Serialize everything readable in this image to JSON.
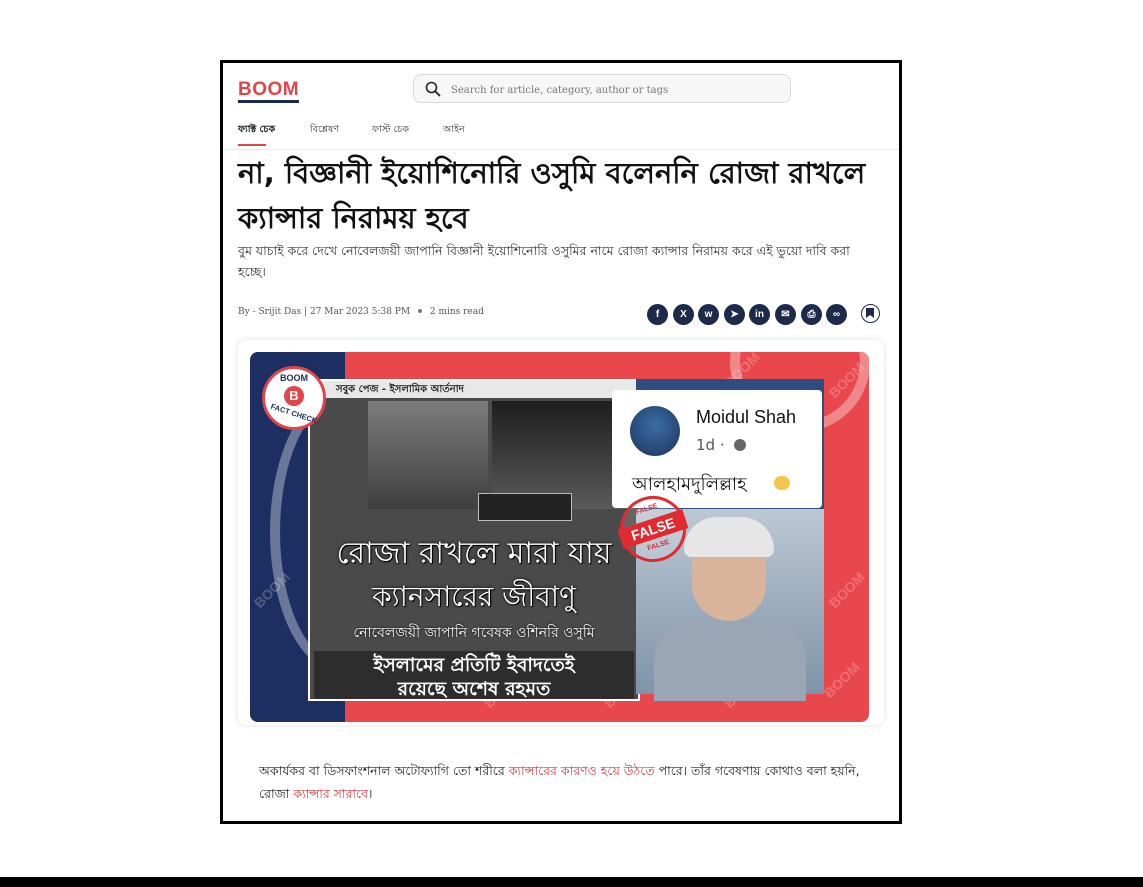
{
  "site": {
    "logo": "BOOM"
  },
  "search": {
    "placeholder": "Search for article, category, author or tags"
  },
  "nav": {
    "tabs": [
      {
        "label": "ফ্যাক্ট চেক",
        "active": true
      },
      {
        "label": "বিশ্লেষণ",
        "active": false
      },
      {
        "label": "ফাস্ট চেক",
        "active": false
      },
      {
        "label": "আইন",
        "active": false
      }
    ]
  },
  "article": {
    "headline": "না, বিজ্ঞানী ইয়োশিনোরি ওসুমি বলেননি রোজা রাখলে ক্যান্সার নিরাময় হবে",
    "subtitle": "বুম যাচাই করে দেখে নোবেলজয়ী জাপানি বিজ্ঞানী ইয়োশিনোরি ওসুমির নামে রোজা ক্যান্সার নিরাময় করে এই ভুয়ো দাবি করা হচ্ছে।",
    "byline": {
      "author": "By - Srijit Das",
      "date": "27 Mar 2023 5:38 PM",
      "read_time": "2 mins read"
    },
    "share_buttons": [
      {
        "name": "facebook",
        "glyph": "f"
      },
      {
        "name": "x-twitter",
        "glyph": "X"
      },
      {
        "name": "whatsapp",
        "glyph": "w"
      },
      {
        "name": "telegram",
        "glyph": "➤"
      },
      {
        "name": "linkedin",
        "glyph": "in"
      },
      {
        "name": "email",
        "glyph": "✉"
      },
      {
        "name": "print",
        "glyph": "⎙"
      },
      {
        "name": "copy-link",
        "glyph": "∞"
      }
    ],
    "body_text": {
      "part1": "অকার্যকর বা ডিসফাংশনাল অটোফ্যাগি তো শরীরে ",
      "link1": "ক্যান্সারের কারণও হয়ে উঠতে",
      "part2": " পারে। তাঁর গবেষণায় কোথাও বলা হয়নি, রোজা ",
      "link2": "ক্যান্সার সারাবে",
      "part3": "।"
    }
  },
  "hero_image": {
    "badge_top": "BOOM",
    "badge_letter": "B",
    "badge_bottom": "FACT CHECK",
    "watermark": "BOOM",
    "left_post": {
      "caption": "সবুক পেজ - ইসলামিক আর্তনাদ",
      "line1": "রোজা রাখলে মারা যায়",
      "line2": "ক্যানসারের জীবাণু",
      "line3": "নোবেলজয়ী জাপানি গবেষক ওশিনরি ওসুমি",
      "line4": "ইসলামের প্রতিটি ইবাদতেই",
      "line5": "রয়েছে অশেষ রহমত"
    },
    "fb_post": {
      "name": "Moidul Shah",
      "time": "1d ·",
      "message": "আলহামদুলিল্লাহ"
    },
    "stamp": {
      "label": "FALSE",
      "small": "FALSE"
    },
    "colors": {
      "red": "#e8474c",
      "navy": "#1d2f62"
    }
  }
}
